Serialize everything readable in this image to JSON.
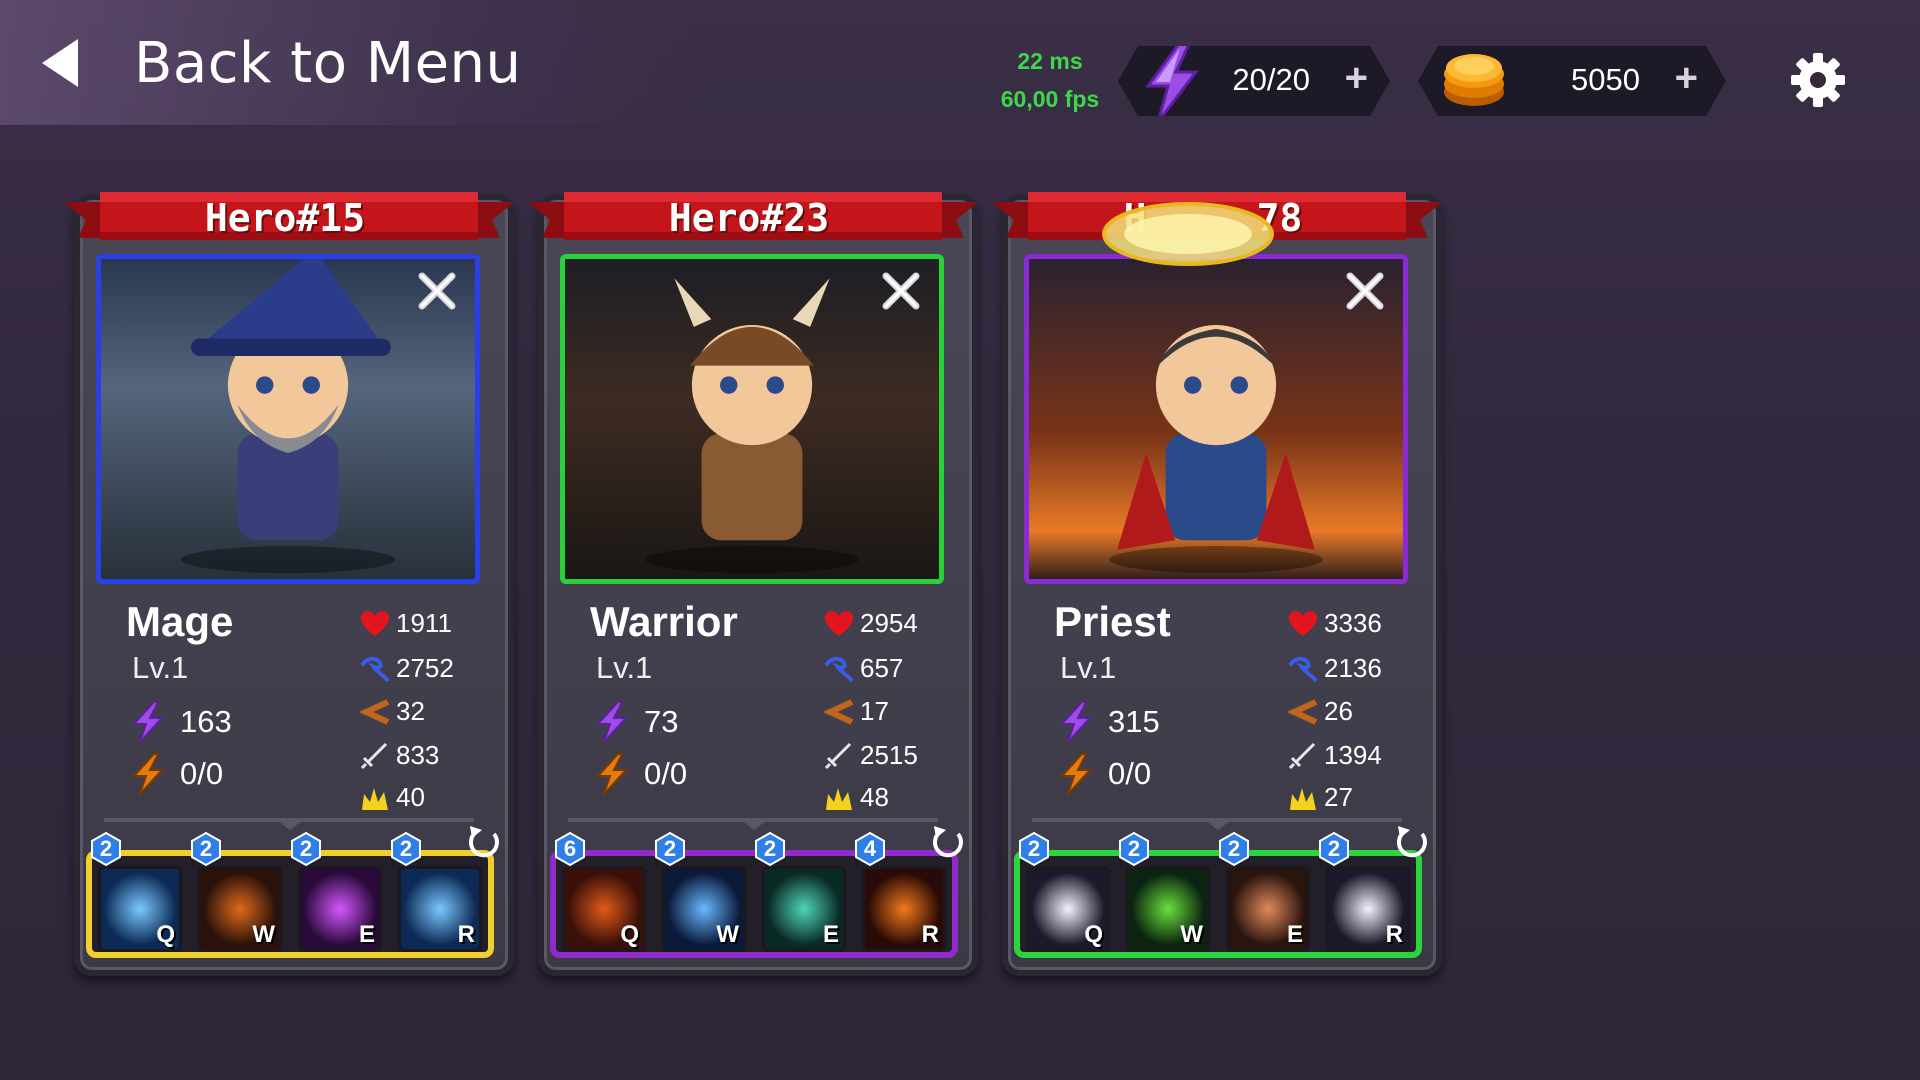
{
  "header": {
    "back_label": "Back to Menu",
    "latency": "22 ms",
    "fps": "60,00 fps",
    "energy": "20/20",
    "gold": "5050",
    "plus": "+"
  },
  "colors": {
    "banner_red": "#c4151b",
    "perf_green": "#3fd64a",
    "mage_frame": "#2b3fe6",
    "warrior_frame": "#27d13a",
    "priest_frame": "#8a2ad6",
    "mage_skillbar": "#f2d02c",
    "warrior_skillbar": "#8f2bc9",
    "priest_skillbar": "#2ad63c"
  },
  "heroes": [
    {
      "banner": "Hero#15",
      "name": "Mage",
      "level": "Lv.1",
      "power": "163",
      "charge": "0/0",
      "hp": "1911",
      "mana": "2752",
      "armor": "32",
      "attack": "833",
      "crit": "40",
      "skills": [
        {
          "key": "Q",
          "level": "2",
          "icon": "ice-burst-icon"
        },
        {
          "key": "W",
          "level": "2",
          "icon": "fire-vortex-icon"
        },
        {
          "key": "E",
          "level": "2",
          "icon": "arcane-slash-icon"
        },
        {
          "key": "R",
          "level": "2",
          "icon": "ice-burst-icon"
        }
      ]
    },
    {
      "banner": "Hero#23",
      "name": "Warrior",
      "level": "Lv.1",
      "power": "73",
      "charge": "0/0",
      "hp": "2954",
      "mana": "657",
      "armor": "17",
      "attack": "2515",
      "crit": "48",
      "skills": [
        {
          "key": "Q",
          "level": "6",
          "icon": "rage-icon"
        },
        {
          "key": "W",
          "level": "2",
          "icon": "ice-blade-icon"
        },
        {
          "key": "E",
          "level": "2",
          "icon": "spin-slash-icon"
        },
        {
          "key": "R",
          "level": "4",
          "icon": "flame-sword-icon"
        }
      ]
    },
    {
      "banner": "H",
      "banner_tail": "78",
      "name": "Priest",
      "level": "Lv.1",
      "power": "315",
      "charge": "0/0",
      "hp": "3336",
      "mana": "2136",
      "armor": "26",
      "attack": "1394",
      "crit": "27",
      "skills": [
        {
          "key": "Q",
          "level": "2",
          "icon": "holy-orb-icon"
        },
        {
          "key": "W",
          "level": "2",
          "icon": "nature-leaf-icon"
        },
        {
          "key": "E",
          "level": "2",
          "icon": "ground-smash-icon"
        },
        {
          "key": "R",
          "level": "2",
          "icon": "holy-orb-icon"
        }
      ]
    }
  ]
}
